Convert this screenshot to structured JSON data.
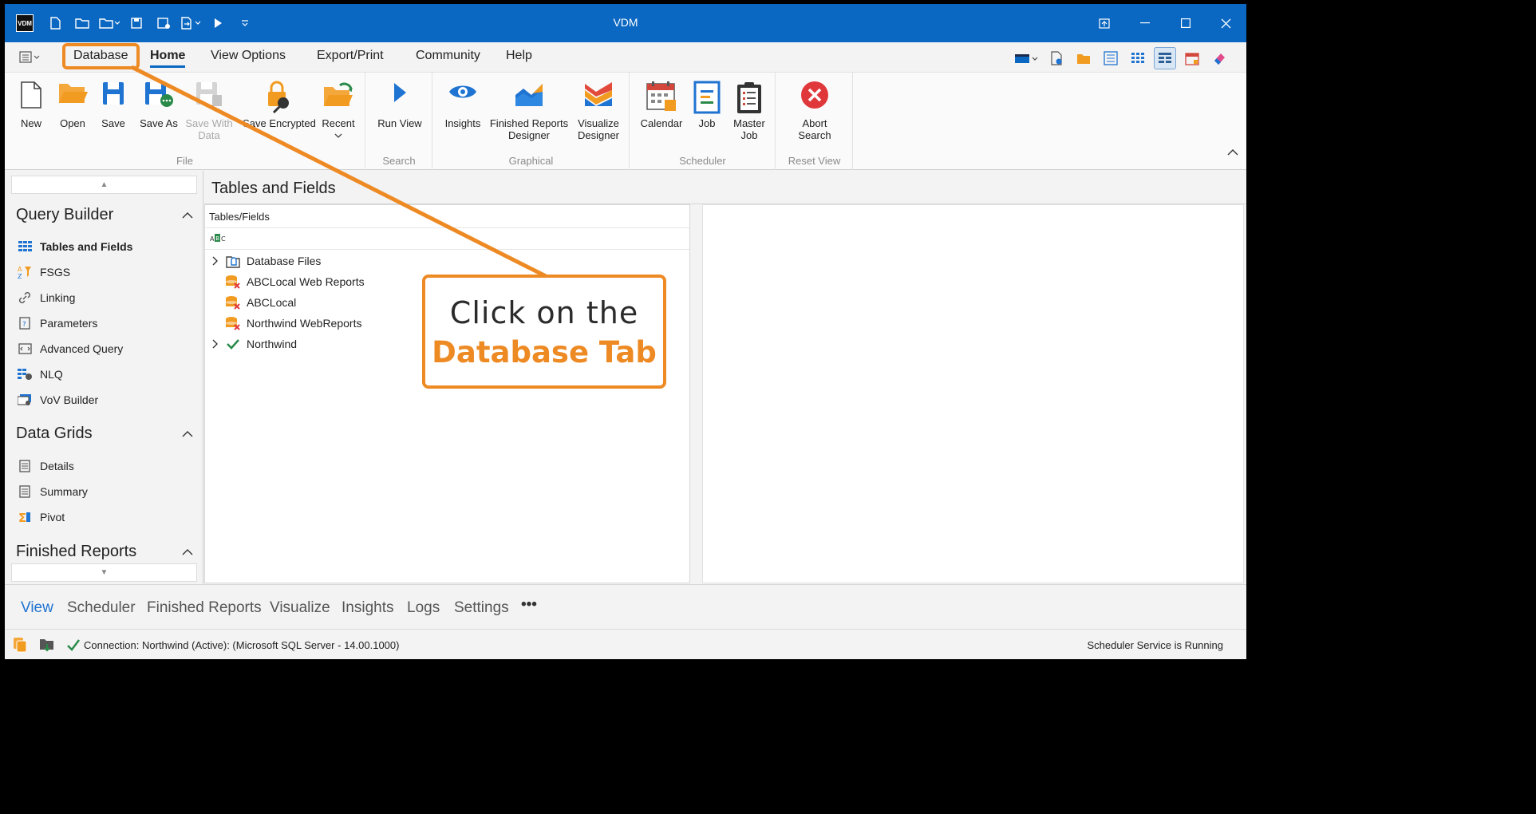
{
  "app": {
    "logo": "VDM",
    "title": "VDM"
  },
  "ribbon_tabs": [
    "Database",
    "Home",
    "View Options",
    "Export/Print",
    "Community",
    "Help"
  ],
  "ribbon": {
    "file": {
      "name": "File",
      "new": "New",
      "open": "Open",
      "save": "Save",
      "save_as": "Save As",
      "save_with_data": "Save With Data",
      "save_encrypted": "Save Encrypted",
      "recent": "Recent"
    },
    "search": {
      "name": "Search",
      "run_view": "Run View"
    },
    "graphical": {
      "name": "Graphical",
      "insights": "Insights",
      "finished_reports_designer": "Finished Reports Designer",
      "visualize_designer": "Visualize Designer"
    },
    "scheduler": {
      "name": "Scheduler",
      "calendar": "Calendar",
      "job": "Job",
      "master_job": "Master Job"
    },
    "reset_view": {
      "name": "Reset View",
      "abort_search": "Abort Search"
    }
  },
  "sidebar": {
    "query_builder": {
      "title": "Query Builder",
      "items": [
        "Tables and Fields",
        "FSGS",
        "Linking",
        "Parameters",
        "Advanced Query",
        "NLQ",
        "VoV Builder"
      ]
    },
    "data_grids": {
      "title": "Data Grids",
      "items": [
        "Details",
        "Summary",
        "Pivot"
      ]
    },
    "finished_reports": {
      "title": "Finished Reports"
    }
  },
  "main": {
    "title": "Tables and Fields",
    "tree_header": "Tables/Fields",
    "tree": [
      "Database Files",
      "ABCLocal Web Reports",
      "ABCLocal",
      "Northwind WebReports",
      "Northwind"
    ]
  },
  "bottom_nav": [
    "View",
    "Scheduler",
    "Finished Reports",
    "Visualize",
    "Insights",
    "Logs",
    "Settings",
    "•••"
  ],
  "status": {
    "connection": "Connection: Northwind (Active): (Microsoft SQL Server - 14.00.1000)",
    "scheduler": "Scheduler Service is Running"
  },
  "annotation": {
    "line1": "Click on the",
    "line2": "Database Tab"
  },
  "colors": {
    "titlebar": "#0a67c2",
    "accent_orange": "#ee8a24"
  }
}
